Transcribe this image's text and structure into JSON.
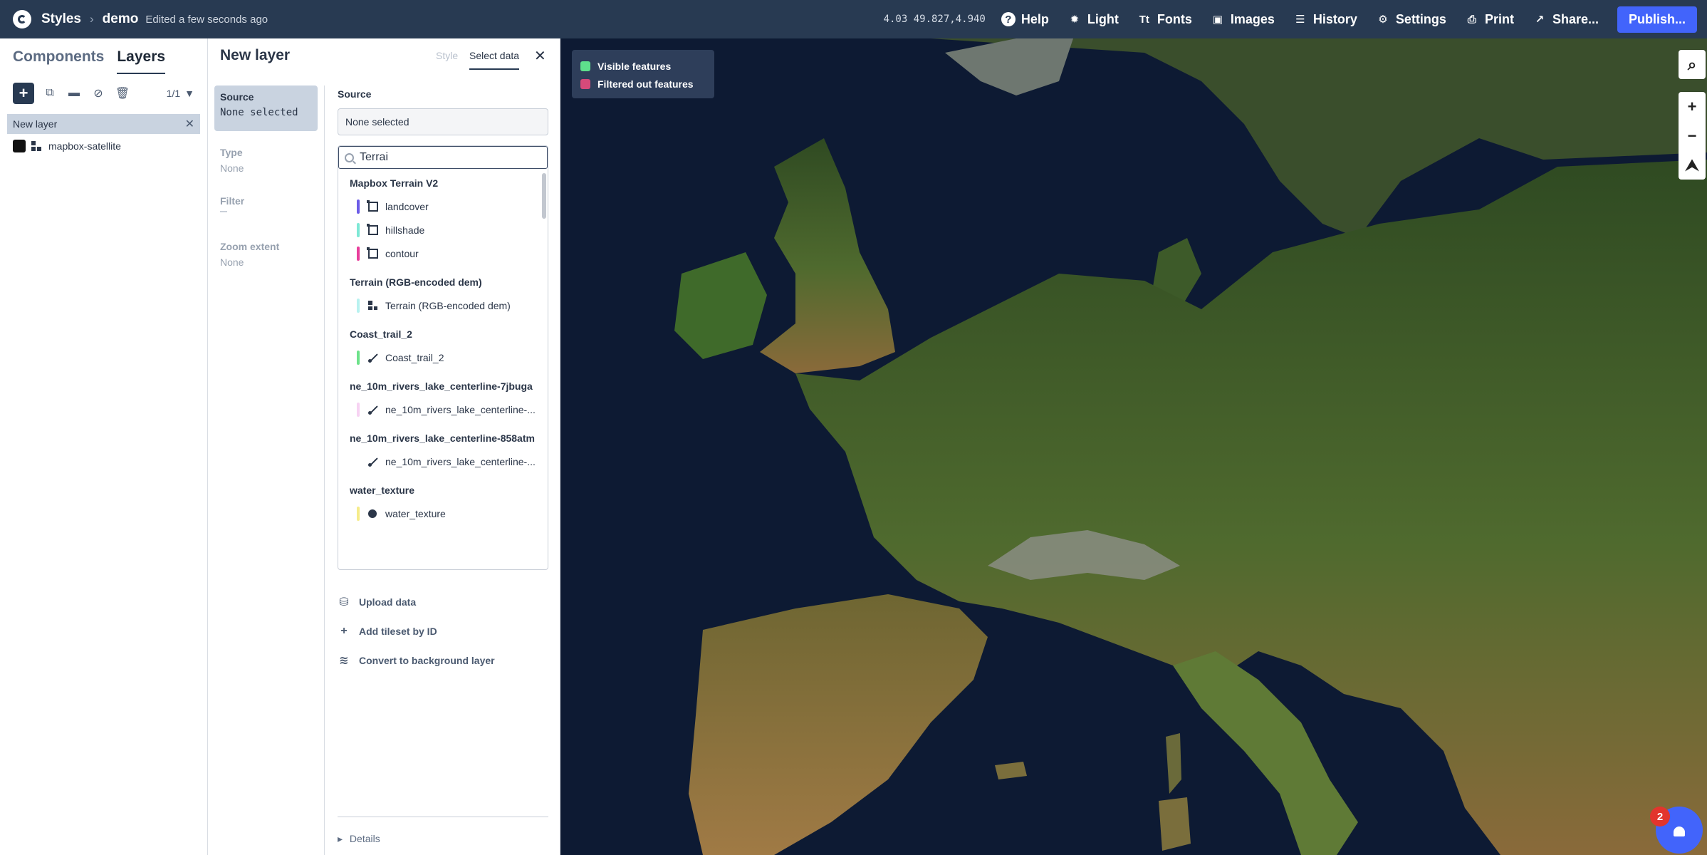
{
  "header": {
    "app": "Styles",
    "style_name": "demo",
    "edited": "Edited a few seconds ago",
    "coords": "4.03 49.827,4.940",
    "buttons": {
      "help": "Help",
      "light": "Light",
      "fonts": "Fonts",
      "images": "Images",
      "history": "History",
      "settings": "Settings",
      "print": "Print",
      "share": "Share...",
      "publish": "Publish..."
    }
  },
  "left_panel": {
    "tabs": [
      "Components",
      "Layers"
    ],
    "active_tab": "Layers",
    "count": "1/1",
    "selected_layer": "New layer",
    "layers": [
      {
        "name": "mapbox-satellite"
      }
    ]
  },
  "editor": {
    "title": "New layer",
    "tabs": {
      "style": "Style",
      "select_data": "Select data"
    },
    "properties": {
      "source_label": "Source",
      "source_value": "None selected",
      "type_label": "Type",
      "type_value": "None",
      "filter_label": "Filter",
      "zoom_label": "Zoom extent",
      "zoom_value": "None"
    },
    "source_heading": "Source",
    "source_selected": "None selected",
    "search_value": "Terrai",
    "groups": [
      {
        "title": "Mapbox Terrain V2",
        "items": [
          {
            "name": "landcover",
            "color": "#6c5ce7",
            "icon": "vector-icon"
          },
          {
            "name": "hillshade",
            "color": "#7ee8d6",
            "icon": "vector-icon"
          },
          {
            "name": "contour",
            "color": "#e83e9b",
            "icon": "vector-icon"
          }
        ]
      },
      {
        "title": "Terrain (RGB-encoded dem)",
        "items": [
          {
            "name": "Terrain (RGB-encoded dem)",
            "color": "#b8f2f0",
            "icon": "raster-icon"
          }
        ]
      },
      {
        "title": "Coast_trail_2",
        "items": [
          {
            "name": "Coast_trail_2",
            "color": "#6de28a",
            "icon": "line-icon"
          }
        ]
      },
      {
        "title": "ne_10m_rivers_lake_centerline-7jbuga",
        "items": [
          {
            "name": "ne_10m_rivers_lake_centerline-...",
            "color": "#f7d3f3",
            "icon": "line-icon"
          }
        ]
      },
      {
        "title": "ne_10m_rivers_lake_centerline-858atm",
        "items": [
          {
            "name": "ne_10m_rivers_lake_centerline-...",
            "color": "#ffffff",
            "icon": "line-icon"
          }
        ]
      },
      {
        "title": "water_texture",
        "items": [
          {
            "name": "water_texture",
            "color": "#f6ec8a",
            "icon": "point-icon"
          }
        ]
      }
    ],
    "actions": {
      "upload": "Upload data",
      "add_tileset": "Add tileset by ID",
      "convert": "Convert to background layer"
    },
    "details": "Details"
  },
  "map": {
    "legend": [
      {
        "label": "Visible features",
        "color": "#5ee08c"
      },
      {
        "label": "Filtered out features",
        "color": "#d64a7a"
      }
    ],
    "notification_count": "2"
  }
}
